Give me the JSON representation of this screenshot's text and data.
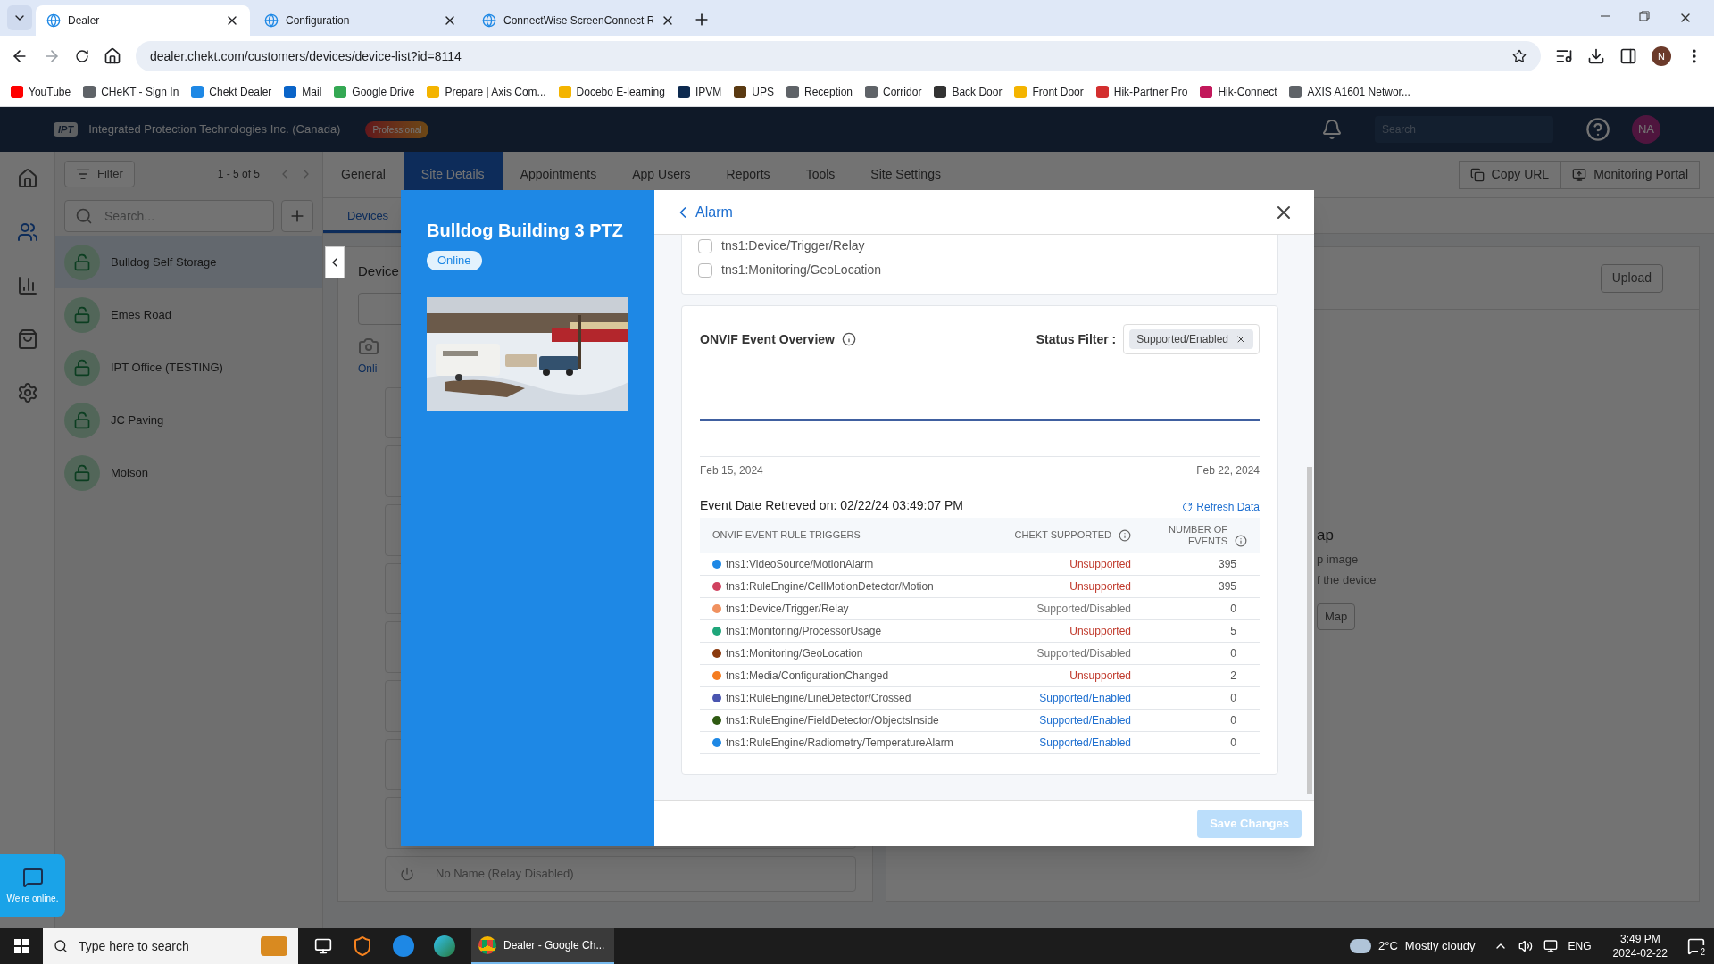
{
  "browser": {
    "tabs": [
      {
        "title": "Dealer",
        "selected": true
      },
      {
        "title": "Configuration",
        "selected": false
      },
      {
        "title": "ConnectWise ScreenConnect R",
        "selected": false
      }
    ],
    "url": "dealer.chekt.com/customers/devices/device-list?id=8114",
    "profile_initial": "N",
    "bookmarks": [
      {
        "label": "YouTube",
        "color": "#ff0000"
      },
      {
        "label": "CHeKT - Sign In",
        "color": "#5f6368"
      },
      {
        "label": "Chekt Dealer",
        "color": "#1e88e5"
      },
      {
        "label": "Mail",
        "color": "#0a64c8"
      },
      {
        "label": "Google Drive",
        "color": "#34a853"
      },
      {
        "label": "Prepare | Axis Com...",
        "color": "#f4b400"
      },
      {
        "label": "Docebo E-learning",
        "color": "#f4b400"
      },
      {
        "label": "IPVM",
        "color": "#0d2a4f"
      },
      {
        "label": "UPS",
        "color": "#5a3a12"
      },
      {
        "label": "Reception",
        "color": "#5f6368"
      },
      {
        "label": "Corridor",
        "color": "#5f6368"
      },
      {
        "label": "Back Door",
        "color": "#333333"
      },
      {
        "label": "Front Door",
        "color": "#f4b400"
      },
      {
        "label": "Hik-Partner Pro",
        "color": "#d32f2f"
      },
      {
        "label": "Hik-Connect",
        "color": "#c2185b"
      },
      {
        "label": "AXIS A1601 Networ...",
        "color": "#5f6368"
      }
    ]
  },
  "header": {
    "logo": "IPT",
    "company": "Integrated Protection Technologies Inc. (Canada)",
    "plan": "Professional",
    "search_placeholder": "Search",
    "avatar": "NA"
  },
  "sidebar": {
    "filter": "Filter",
    "range": "1 - 5 of 5",
    "search_placeholder": "Search...",
    "sites": [
      {
        "name": "Bulldog Self Storage",
        "selected": true
      },
      {
        "name": "Emes Road",
        "selected": false
      },
      {
        "name": "IPT Office (TESTING)",
        "selected": false
      },
      {
        "name": "JC Paving",
        "selected": false
      },
      {
        "name": "Molson",
        "selected": false
      }
    ]
  },
  "tabs": [
    {
      "label": "General",
      "selected": false
    },
    {
      "label": "Site Details",
      "selected": true
    },
    {
      "label": "Appointments",
      "selected": false
    },
    {
      "label": "App Users",
      "selected": false
    },
    {
      "label": "Reports",
      "selected": false
    },
    {
      "label": "Tools",
      "selected": false
    },
    {
      "label": "Site Settings",
      "selected": false
    }
  ],
  "actions": [
    "Copy URL",
    "Monitoring Portal"
  ],
  "subtabs": [
    {
      "label": "Devices",
      "selected": true
    }
  ],
  "devices_panel": {
    "title": "Device",
    "status": "Onli",
    "last_device": "No Name (Relay Disabled)"
  },
  "map_panel": {
    "upload": "Upload",
    "title": "ap",
    "lines": [
      "p image",
      "f the device"
    ],
    "button": "Map"
  },
  "modal": {
    "device_name": "Bulldog Building 3 PTZ",
    "status": "Online",
    "back": "Alarm",
    "triggers": [
      {
        "label": "tns1:Device/Trigger/Relay",
        "checked": false
      },
      {
        "label": "tns1:Monitoring/GeoLocation",
        "checked": false
      }
    ],
    "overview": {
      "title": "ONVIF Event Overview",
      "filter_label": "Status Filter :",
      "filter_chip": "Supported/Enabled",
      "date_start": "Feb 15, 2024",
      "date_end": "Feb 22, 2024",
      "retrieved": "Event Date Retreved on: 02/22/24 03:49:07 PM",
      "refresh": "Refresh Data",
      "columns": [
        "ONVIF EVENT RULE TRIGGERS",
        "CHEKT SUPPORTED",
        "NUMBER OF EVENTS"
      ],
      "rows": [
        {
          "trigger": "tns1:VideoSource/MotionAlarm",
          "color": "#1e88e5",
          "status": "Unsupported",
          "kind": "unsupported",
          "events": "395"
        },
        {
          "trigger": "tns1:RuleEngine/CellMotionDetector/Motion",
          "color": "#d0415f",
          "status": "Unsupported",
          "kind": "unsupported",
          "events": "395"
        },
        {
          "trigger": "tns1:Device/Trigger/Relay",
          "color": "#f0915f",
          "status": "Supported/Disabled",
          "kind": "disabled",
          "events": "0"
        },
        {
          "trigger": "tns1:Monitoring/ProcessorUsage",
          "color": "#1fa67a",
          "status": "Unsupported",
          "kind": "unsupported",
          "events": "5"
        },
        {
          "trigger": "tns1:Monitoring/GeoLocation",
          "color": "#8b3a0e",
          "status": "Supported/Disabled",
          "kind": "disabled",
          "events": "0"
        },
        {
          "trigger": "tns1:Media/ConfigurationChanged",
          "color": "#f57c20",
          "status": "Unsupported",
          "kind": "unsupported",
          "events": "2"
        },
        {
          "trigger": "tns1:RuleEngine/LineDetector/Crossed",
          "color": "#4a55b0",
          "status": "Supported/Enabled",
          "kind": "enabled",
          "events": "0"
        },
        {
          "trigger": "tns1:RuleEngine/FieldDetector/ObjectsInside",
          "color": "#2f5a12",
          "status": "Supported/Enabled",
          "kind": "enabled",
          "events": "0"
        },
        {
          "trigger": "tns1:RuleEngine/Radiometry/TemperatureAlarm",
          "color": "#1e88e5",
          "status": "Supported/Enabled",
          "kind": "enabled",
          "events": "0"
        }
      ]
    },
    "save": "Save Changes",
    "save_disabled": true
  },
  "chat": {
    "label": "We're online."
  },
  "taskbar": {
    "search_placeholder": "Type here to search",
    "window": "Dealer - Google Ch...",
    "temperature": "2°C",
    "weather": "Mostly cloudy",
    "language": "ENG",
    "time": "3:49 PM",
    "date": "2024-02-22",
    "notifications": "2"
  }
}
